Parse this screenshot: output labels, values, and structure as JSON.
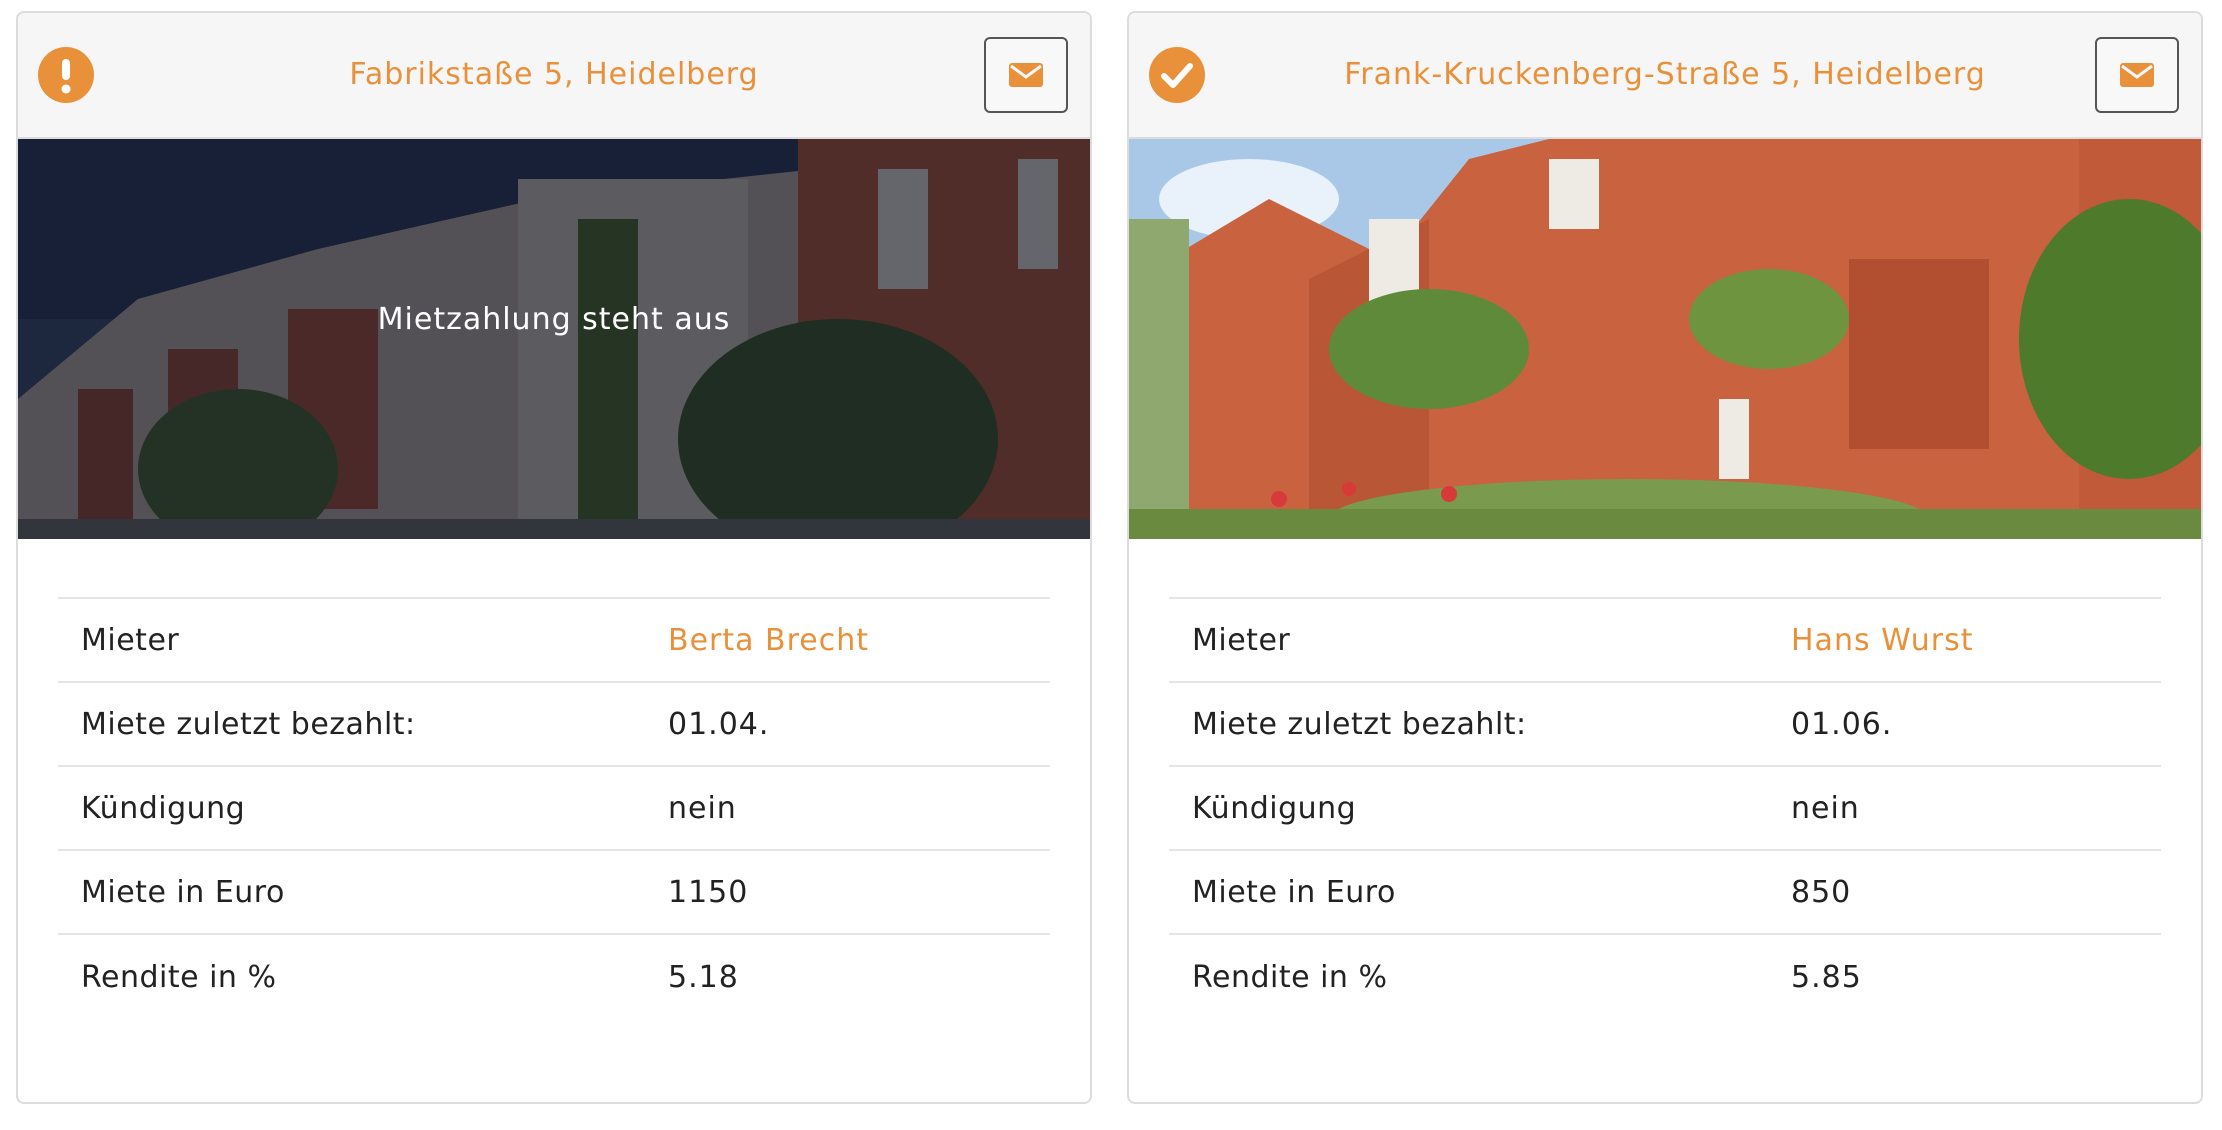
{
  "accent_color": "#e8913a",
  "cards": [
    {
      "address": "Fabrikstaße 5, Heidelberg",
      "status_icon": "exclamation-circle-icon",
      "action_icon": "envelope-icon",
      "photo_notice": "Mietzahlung steht aus",
      "rows": [
        {
          "label": "Mieter",
          "value": "Berta Brecht"
        },
        {
          "label": "Miete zuletzt bezahlt:",
          "value": "01.04."
        },
        {
          "label": "Kündigung",
          "value": "nein"
        },
        {
          "label": "Miete in Euro",
          "value": "1150"
        },
        {
          "label": "Rendite in %",
          "value": "5.18"
        }
      ]
    },
    {
      "address": "Frank-Kruckenberg-Straße 5, Heidelberg",
      "status_icon": "check-circle-icon",
      "action_icon": "envelope-icon",
      "rows": [
        {
          "label": "Mieter",
          "value": "Hans Wurst"
        },
        {
          "label": "Miete zuletzt bezahlt:",
          "value": "01.06."
        },
        {
          "label": "Kündigung",
          "value": "nein"
        },
        {
          "label": "Miete in Euro",
          "value": "850"
        },
        {
          "label": "Rendite in %",
          "value": "5.85"
        }
      ]
    }
  ]
}
